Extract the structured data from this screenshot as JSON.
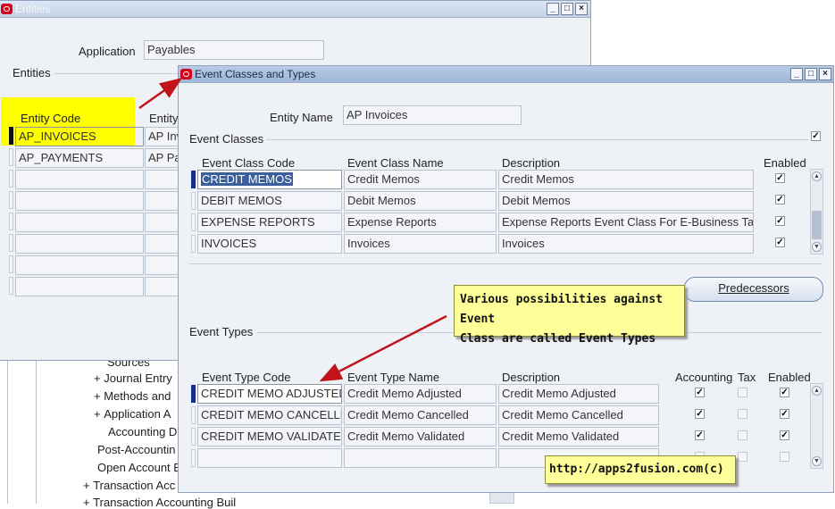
{
  "entities_window": {
    "title": "Entities",
    "application_label": "Application",
    "application_value": "Payables",
    "section_label": "Entities",
    "col_entity_code": "Entity Code",
    "col_entity": "Entity",
    "rows": [
      {
        "code": "AP_INVOICES",
        "name": "AP Inv"
      },
      {
        "code": "AP_PAYMENTS",
        "name": "AP Pa"
      }
    ]
  },
  "tree": {
    "items": [
      {
        "prefix": "+",
        "label": "Journal Entry"
      },
      {
        "prefix": "+",
        "label": "Methods and"
      },
      {
        "prefix": "+",
        "label": "Application A"
      },
      {
        "prefix": "",
        "label": "Accounting D"
      },
      {
        "prefix": "",
        "label": "Post-Accountin"
      },
      {
        "prefix": "",
        "label": "Open Account B"
      },
      {
        "prefix": "+",
        "label": "Transaction Acc"
      },
      {
        "prefix": "+",
        "label": "Transaction Accounting Buil"
      }
    ],
    "partial_item": "Sources"
  },
  "event_window": {
    "title": "Event Classes and Types",
    "entity_name_label": "Entity Name",
    "entity_name_value": "AP Invoices",
    "event_classes_label": "Event Classes",
    "class_headers": {
      "code": "Event Class Code",
      "name": "Event Class Name",
      "description": "Description",
      "enabled": "Enabled"
    },
    "classes": [
      {
        "code": "CREDIT MEMOS",
        "name": "Credit Memos",
        "description": "Credit Memos",
        "enabled": true
      },
      {
        "code": "DEBIT MEMOS",
        "name": "Debit Memos",
        "description": "Debit Memos",
        "enabled": true
      },
      {
        "code": "EXPENSE REPORTS",
        "name": "Expense Reports",
        "description": "Expense Reports Event Class For E-Business Ta",
        "enabled": true
      },
      {
        "code": "INVOICES",
        "name": "Invoices",
        "description": "Invoices",
        "enabled": true
      }
    ],
    "predecessors_button": "Predecessors",
    "event_types_label": "Event Types",
    "type_headers": {
      "code": "Event Type Code",
      "name": "Event Type Name",
      "description": "Description",
      "accounting": "Accounting",
      "tax": "Tax",
      "enabled": "Enabled"
    },
    "types": [
      {
        "code": "CREDIT MEMO ADJUSTED",
        "name": "Credit Memo Adjusted",
        "description": "Credit Memo Adjusted",
        "accounting": true,
        "tax": false,
        "enabled": true
      },
      {
        "code": "CREDIT MEMO CANCELLED",
        "name": "Credit Memo Cancelled",
        "description": "Credit Memo Cancelled",
        "accounting": true,
        "tax": false,
        "enabled": true
      },
      {
        "code": "CREDIT MEMO VALIDATED",
        "name": "Credit Memo Validated",
        "description": "Credit Memo Validated",
        "accounting": true,
        "tax": false,
        "enabled": true
      }
    ]
  },
  "callouts": {
    "event_types_note_line1": "Various possibilities against Event",
    "event_types_note_line2": "Class are called Event Types",
    "url": "http://apps2fusion.com(c)"
  },
  "colors": {
    "highlight": "#ffff00",
    "callout": "#ffff99",
    "arrow": "#c0141a",
    "oracle_red": "#d4001a"
  }
}
